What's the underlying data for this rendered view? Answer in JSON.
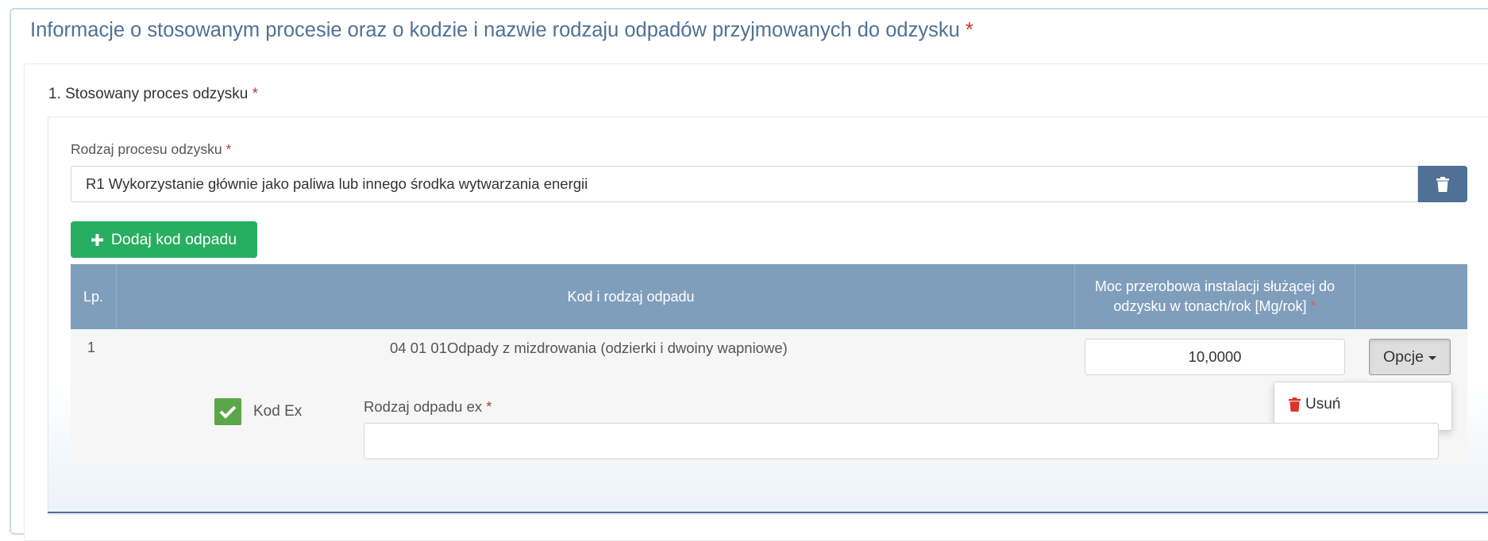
{
  "heading": {
    "text": "Informacje o stosowanym procesie oraz o kodzie i nazwie rodzaju odpadów przyjmowanych do odzysku",
    "required_mark": "*"
  },
  "section": {
    "title": "1. Stosowany proces odzysku",
    "required_mark": "*"
  },
  "process_field": {
    "label": "Rodzaj procesu odzysku",
    "required_mark": "*",
    "value": "R1 Wykorzystanie głównie jako paliwa lub innego środka wytwarzania energii",
    "delete_icon": "trash-icon"
  },
  "add_button": {
    "label": "Dodaj kod odpadu",
    "icon": "plus-icon"
  },
  "table": {
    "headers": {
      "lp": "Lp.",
      "kod": "Kod i rodzaj odpadu",
      "moc_line1": "Moc przerobowa instalacji służącej do",
      "moc_line2": "odzysku w tonach/rok [Mg/rok]",
      "moc_required": "*"
    },
    "rows": [
      {
        "lp": "1",
        "kod": "04 01 01Odpady z mizdrowania (odzierki i dwoiny wapniowe)",
        "moc": "10,0000",
        "options_label": "Opcje",
        "kod_ex_checked": true,
        "kod_ex_label": "Kod Ex",
        "ex_field_label": "Rodzaj odpadu ex",
        "ex_field_required": "*",
        "ex_field_value": ""
      }
    ]
  },
  "dropdown": {
    "items": [
      {
        "label": "Usuń",
        "icon": "trash-icon"
      }
    ]
  },
  "colors": {
    "heading": "#4f7195",
    "table_header": "#7f9ebc",
    "add_button": "#27ae60",
    "checkbox": "#5aa64a",
    "required": "#c0392b",
    "delete_red": "#d9342b"
  }
}
